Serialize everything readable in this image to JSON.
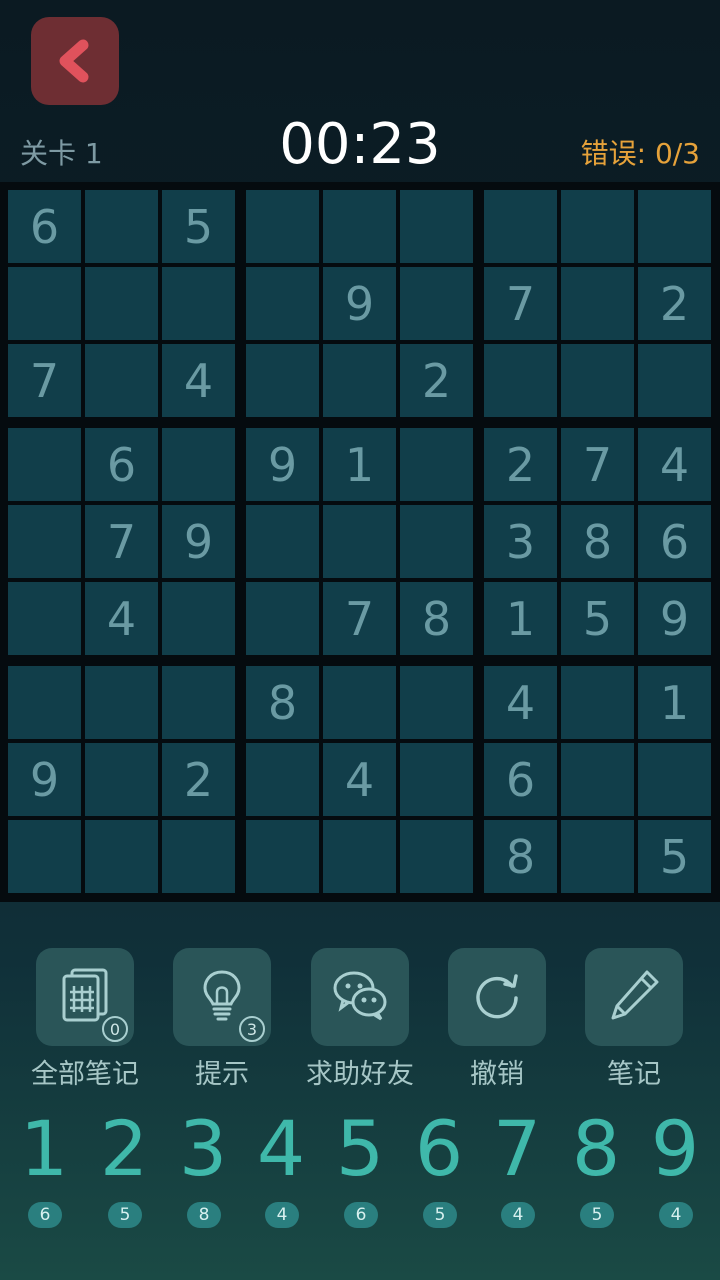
{
  "header": {
    "level": "关卡 1",
    "timer": "00:23",
    "errors_label": "错误: ",
    "errors_value": "0/3"
  },
  "board": {
    "rows": [
      [
        "6",
        "",
        "5",
        "",
        "",
        "",
        "",
        "",
        ""
      ],
      [
        "",
        "",
        "",
        "",
        "9",
        "",
        "7",
        "",
        "2"
      ],
      [
        "7",
        "",
        "4",
        "",
        "",
        "2",
        "",
        "",
        ""
      ],
      [
        "",
        "6",
        "",
        "9",
        "1",
        "",
        "2",
        "7",
        "4"
      ],
      [
        "",
        "7",
        "9",
        "",
        "",
        "",
        "3",
        "8",
        "6"
      ],
      [
        "",
        "4",
        "",
        "",
        "7",
        "8",
        "1",
        "5",
        "9"
      ],
      [
        "",
        "",
        "",
        "8",
        "",
        "",
        "4",
        "",
        "1"
      ],
      [
        "9",
        "",
        "2",
        "",
        "4",
        "",
        "6",
        "",
        ""
      ],
      [
        "",
        "",
        "",
        "",
        "",
        "",
        "8",
        "",
        "5"
      ]
    ]
  },
  "tools": [
    {
      "name": "all-notes",
      "label": "全部笔记",
      "icon": "notes-grid-icon",
      "badge": "0"
    },
    {
      "name": "hint",
      "label": "提示",
      "icon": "lightbulb-icon",
      "badge": "3"
    },
    {
      "name": "ask-friend",
      "label": "求助好友",
      "icon": "wechat-icon",
      "badge": null
    },
    {
      "name": "undo",
      "label": "撤销",
      "icon": "undo-icon",
      "badge": null
    },
    {
      "name": "note",
      "label": "笔记",
      "icon": "pencil-icon",
      "badge": null
    }
  ],
  "numpad": [
    {
      "digit": "1",
      "count": "6"
    },
    {
      "digit": "2",
      "count": "5"
    },
    {
      "digit": "3",
      "count": "8"
    },
    {
      "digit": "4",
      "count": "4"
    },
    {
      "digit": "5",
      "count": "6"
    },
    {
      "digit": "6",
      "count": "5"
    },
    {
      "digit": "7",
      "count": "4"
    },
    {
      "digit": "8",
      "count": "5"
    },
    {
      "digit": "9",
      "count": "4"
    }
  ],
  "colors": {
    "back_button": "#6e2e33",
    "back_chevron": "#e0525c",
    "timer": "#ffffff",
    "errors": "#e6a23a",
    "cell": "#113e4a",
    "digit": "#6a9aa3",
    "numpad_digit": "#3fb8aa"
  }
}
